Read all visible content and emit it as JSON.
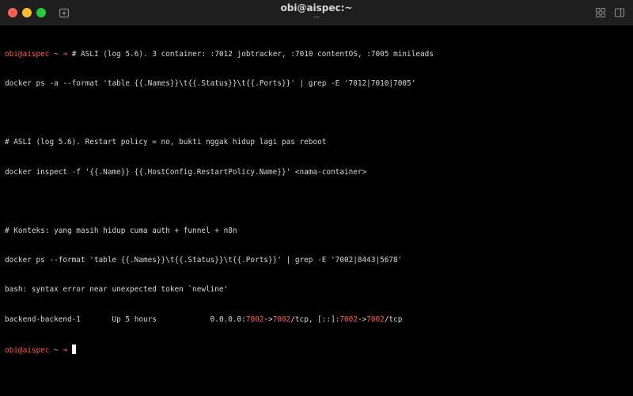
{
  "window": {
    "title": "obi@aispec:~",
    "colors": {
      "close": "#ff5f57",
      "minimize": "#febc2e",
      "maximize": "#28c840",
      "prompt": "#ff5a4e"
    },
    "icons": [
      "new-tab-icon",
      "grid-icon",
      "sidebar-icon"
    ]
  },
  "terminal": {
    "prompt_user": "obi@aispec",
    "prompt_dir": "~",
    "prompt_arrow": "➜",
    "lines": {
      "l1_cmd": "# ASLI (log 5.6). 3 container: :7012 jobtracker, :7010 contentOS, :7005 minileads",
      "l2": "docker ps -a --format 'table {{.Names}}\\t{{.Status}}\\t{{.Ports}}' | grep -E '7012|7010|7005'",
      "l4": "# ASLI (log 5.6). Restart policy = no, bukti nggak hidup lagi pas reboot",
      "l5": "docker inspect -f '{{.Name}} {{.HostConfig.RestartPolicy.Name}}' <nama-container>",
      "l7": "# Konteks: yang masih hidup cuma auth + funnel + n8n",
      "l8": "docker ps --format 'table {{.Names}}\\t{{.Status}}\\t{{.Ports}}' | grep -E '7002|8443|5678'",
      "l9": "bash: syntax error near unexpected token `newline'",
      "l10_name": "backend-backend-1",
      "l10_status": "Up 5 hours",
      "l10_p1": "0.0.0.0:",
      "l10_p2": "7002",
      "l10_p3": "->",
      "l10_p4": "7002",
      "l10_p5": "/tcp, [::]:",
      "l10_p6": "7002",
      "l10_p7": "->",
      "l10_p8": "7002",
      "l10_p9": "/tcp"
    }
  }
}
